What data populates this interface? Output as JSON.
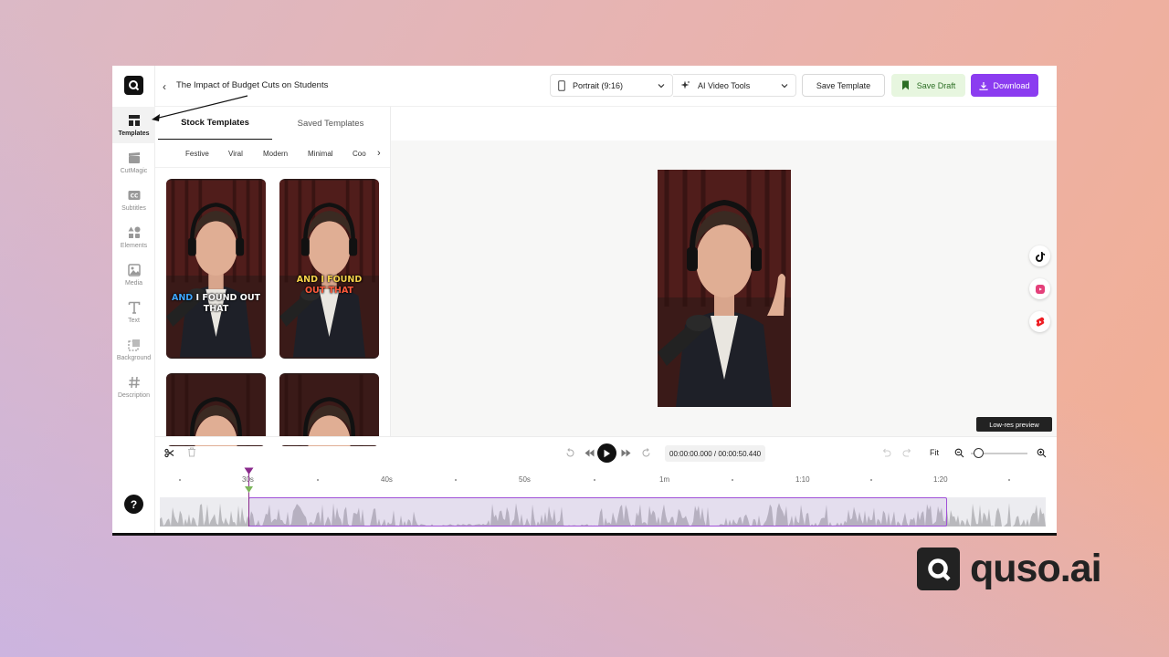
{
  "app": {
    "project_title": "The Impact of Budget Cuts on Students",
    "accent_color": "#8b3cf0"
  },
  "header": {
    "aspect_dropdown": {
      "label": "Portrait (9:16)",
      "icon": "phone-icon"
    },
    "tools_dropdown": {
      "label": "AI Video Tools",
      "icon": "sparkle-icon"
    },
    "save_template_label": "Save Template",
    "save_draft_label": "Save Draft",
    "download_label": "Download"
  },
  "sidebar": {
    "items": [
      {
        "label": "Templates",
        "icon": "templates-icon",
        "active": true
      },
      {
        "label": "CutMagic",
        "icon": "clapper-icon"
      },
      {
        "label": "Subtitles",
        "icon": "cc-icon"
      },
      {
        "label": "Elements",
        "icon": "shapes-icon"
      },
      {
        "label": "Media",
        "icon": "image-icon"
      },
      {
        "label": "Text",
        "icon": "text-icon"
      },
      {
        "label": "Background",
        "icon": "background-icon"
      },
      {
        "label": "Description",
        "icon": "hash-icon"
      }
    ],
    "help": "?"
  },
  "panel": {
    "tabs": [
      {
        "label": "Stock Templates",
        "active": true
      },
      {
        "label": "Saved Templates"
      }
    ],
    "chips": [
      "Festive",
      "Viral",
      "Modern",
      "Minimal",
      "Coo"
    ],
    "templates": [
      {
        "caption_a": "AND",
        "caption_b": "I FOUND OUT",
        "caption_c": "THAT"
      },
      {
        "caption_a": "AND I FOUND",
        "caption_b": "OUT THAT"
      }
    ]
  },
  "preview": {
    "low_res_label": "Low-res preview",
    "share_targets": [
      "tiktok-icon",
      "instagram-reels-icon",
      "youtube-shorts-icon"
    ]
  },
  "timeline": {
    "timecode": "00:00:00.000 / 00:00:50.440",
    "fit_label": "Fit",
    "ruler_labels": [
      "30s",
      "40s",
      "50s",
      "1m",
      "1:10",
      "1:20"
    ]
  },
  "brand": {
    "name": "quso.ai"
  }
}
